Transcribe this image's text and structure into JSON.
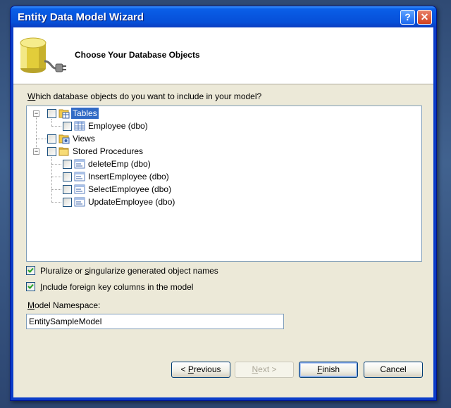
{
  "window": {
    "title": "Entity Data Model Wizard",
    "help_label": "?",
    "close_label": "✕"
  },
  "header": {
    "title": "Choose Your Database Objects"
  },
  "question": {
    "prefix": "",
    "accel": "W",
    "rest": "hich database objects do you want to include in your model?"
  },
  "tree": {
    "tables": {
      "label": "Tables",
      "expanded": true,
      "checked": false,
      "selected": true
    },
    "employee": {
      "label": "Employee (dbo)",
      "checked": false
    },
    "views": {
      "label": "Views",
      "checked": false
    },
    "stored_procedures": {
      "label": "Stored Procedures",
      "expanded": true,
      "checked": false
    },
    "procedures": [
      {
        "label": "deleteEmp (dbo)",
        "checked": false
      },
      {
        "label": "InsertEmployee (dbo)",
        "checked": false
      },
      {
        "label": "SelectEmployee (dbo)",
        "checked": false
      },
      {
        "label": "UpdateEmployee (dbo)",
        "checked": false
      }
    ]
  },
  "options": {
    "pluralize": {
      "before": "Pluralize or ",
      "accel": "s",
      "after": "ingularize generated object names",
      "checked": true
    },
    "foreign_keys": {
      "before": "",
      "accel": "I",
      "after": "nclude foreign key columns in the model",
      "checked": true
    }
  },
  "namespace": {
    "accel": "M",
    "label_rest": "odel Namespace:",
    "value": "EntitySampleModel"
  },
  "buttons": {
    "previous": {
      "before": "< ",
      "accel": "P",
      "after": "revious",
      "enabled": true
    },
    "next": {
      "before": "",
      "accel": "N",
      "after": "ext >",
      "enabled": false
    },
    "finish": {
      "before": "",
      "accel": "F",
      "after": "inish",
      "enabled": true
    },
    "cancel": {
      "label": "Cancel",
      "enabled": true
    }
  },
  "colors": {
    "titlebar": "#0a5fe8",
    "selection": "#316ac5",
    "dialog_bg": "#ece9d8"
  }
}
